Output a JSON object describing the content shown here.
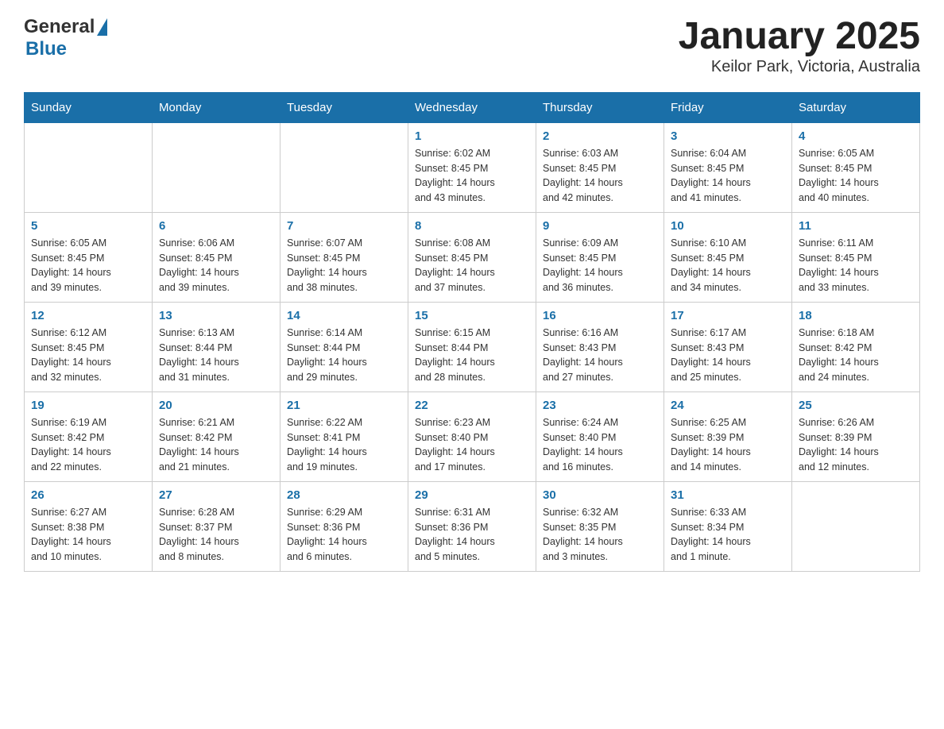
{
  "header": {
    "logo_general": "General",
    "logo_blue": "Blue",
    "title": "January 2025",
    "subtitle": "Keilor Park, Victoria, Australia"
  },
  "days_of_week": [
    "Sunday",
    "Monday",
    "Tuesday",
    "Wednesday",
    "Thursday",
    "Friday",
    "Saturday"
  ],
  "weeks": [
    [
      {
        "day": "",
        "info": ""
      },
      {
        "day": "",
        "info": ""
      },
      {
        "day": "",
        "info": ""
      },
      {
        "day": "1",
        "info": "Sunrise: 6:02 AM\nSunset: 8:45 PM\nDaylight: 14 hours\nand 43 minutes."
      },
      {
        "day": "2",
        "info": "Sunrise: 6:03 AM\nSunset: 8:45 PM\nDaylight: 14 hours\nand 42 minutes."
      },
      {
        "day": "3",
        "info": "Sunrise: 6:04 AM\nSunset: 8:45 PM\nDaylight: 14 hours\nand 41 minutes."
      },
      {
        "day": "4",
        "info": "Sunrise: 6:05 AM\nSunset: 8:45 PM\nDaylight: 14 hours\nand 40 minutes."
      }
    ],
    [
      {
        "day": "5",
        "info": "Sunrise: 6:05 AM\nSunset: 8:45 PM\nDaylight: 14 hours\nand 39 minutes."
      },
      {
        "day": "6",
        "info": "Sunrise: 6:06 AM\nSunset: 8:45 PM\nDaylight: 14 hours\nand 39 minutes."
      },
      {
        "day": "7",
        "info": "Sunrise: 6:07 AM\nSunset: 8:45 PM\nDaylight: 14 hours\nand 38 minutes."
      },
      {
        "day": "8",
        "info": "Sunrise: 6:08 AM\nSunset: 8:45 PM\nDaylight: 14 hours\nand 37 minutes."
      },
      {
        "day": "9",
        "info": "Sunrise: 6:09 AM\nSunset: 8:45 PM\nDaylight: 14 hours\nand 36 minutes."
      },
      {
        "day": "10",
        "info": "Sunrise: 6:10 AM\nSunset: 8:45 PM\nDaylight: 14 hours\nand 34 minutes."
      },
      {
        "day": "11",
        "info": "Sunrise: 6:11 AM\nSunset: 8:45 PM\nDaylight: 14 hours\nand 33 minutes."
      }
    ],
    [
      {
        "day": "12",
        "info": "Sunrise: 6:12 AM\nSunset: 8:45 PM\nDaylight: 14 hours\nand 32 minutes."
      },
      {
        "day": "13",
        "info": "Sunrise: 6:13 AM\nSunset: 8:44 PM\nDaylight: 14 hours\nand 31 minutes."
      },
      {
        "day": "14",
        "info": "Sunrise: 6:14 AM\nSunset: 8:44 PM\nDaylight: 14 hours\nand 29 minutes."
      },
      {
        "day": "15",
        "info": "Sunrise: 6:15 AM\nSunset: 8:44 PM\nDaylight: 14 hours\nand 28 minutes."
      },
      {
        "day": "16",
        "info": "Sunrise: 6:16 AM\nSunset: 8:43 PM\nDaylight: 14 hours\nand 27 minutes."
      },
      {
        "day": "17",
        "info": "Sunrise: 6:17 AM\nSunset: 8:43 PM\nDaylight: 14 hours\nand 25 minutes."
      },
      {
        "day": "18",
        "info": "Sunrise: 6:18 AM\nSunset: 8:42 PM\nDaylight: 14 hours\nand 24 minutes."
      }
    ],
    [
      {
        "day": "19",
        "info": "Sunrise: 6:19 AM\nSunset: 8:42 PM\nDaylight: 14 hours\nand 22 minutes."
      },
      {
        "day": "20",
        "info": "Sunrise: 6:21 AM\nSunset: 8:42 PM\nDaylight: 14 hours\nand 21 minutes."
      },
      {
        "day": "21",
        "info": "Sunrise: 6:22 AM\nSunset: 8:41 PM\nDaylight: 14 hours\nand 19 minutes."
      },
      {
        "day": "22",
        "info": "Sunrise: 6:23 AM\nSunset: 8:40 PM\nDaylight: 14 hours\nand 17 minutes."
      },
      {
        "day": "23",
        "info": "Sunrise: 6:24 AM\nSunset: 8:40 PM\nDaylight: 14 hours\nand 16 minutes."
      },
      {
        "day": "24",
        "info": "Sunrise: 6:25 AM\nSunset: 8:39 PM\nDaylight: 14 hours\nand 14 minutes."
      },
      {
        "day": "25",
        "info": "Sunrise: 6:26 AM\nSunset: 8:39 PM\nDaylight: 14 hours\nand 12 minutes."
      }
    ],
    [
      {
        "day": "26",
        "info": "Sunrise: 6:27 AM\nSunset: 8:38 PM\nDaylight: 14 hours\nand 10 minutes."
      },
      {
        "day": "27",
        "info": "Sunrise: 6:28 AM\nSunset: 8:37 PM\nDaylight: 14 hours\nand 8 minutes."
      },
      {
        "day": "28",
        "info": "Sunrise: 6:29 AM\nSunset: 8:36 PM\nDaylight: 14 hours\nand 6 minutes."
      },
      {
        "day": "29",
        "info": "Sunrise: 6:31 AM\nSunset: 8:36 PM\nDaylight: 14 hours\nand 5 minutes."
      },
      {
        "day": "30",
        "info": "Sunrise: 6:32 AM\nSunset: 8:35 PM\nDaylight: 14 hours\nand 3 minutes."
      },
      {
        "day": "31",
        "info": "Sunrise: 6:33 AM\nSunset: 8:34 PM\nDaylight: 14 hours\nand 1 minute."
      },
      {
        "day": "",
        "info": ""
      }
    ]
  ]
}
